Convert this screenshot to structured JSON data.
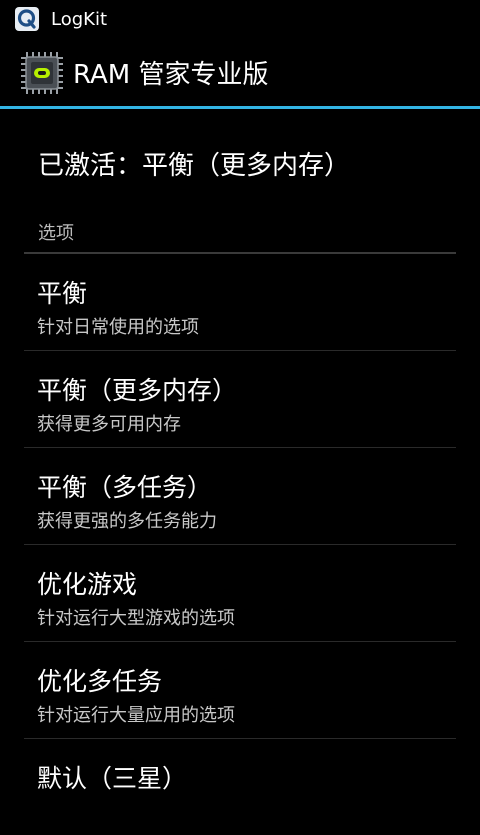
{
  "status_bar": {
    "title": "LogKit",
    "icon": "logkit-icon"
  },
  "action_bar": {
    "title": "RAM 管家专业版",
    "icon": "chip-icon",
    "accent_color": "#33b5e5"
  },
  "active_status": "已激活：平衡（更多内存）",
  "section_header": "选项",
  "options": [
    {
      "title": "平衡",
      "summary": "针对日常使用的选项"
    },
    {
      "title": "平衡（更多内存）",
      "summary": "获得更多可用内存"
    },
    {
      "title": "平衡（多任务）",
      "summary": "获得更强的多任务能力"
    },
    {
      "title": "优化游戏",
      "summary": "针对运行大型游戏的选项"
    },
    {
      "title": "优化多任务",
      "summary": "针对运行大量应用的选项"
    },
    {
      "title": "默认（三星）",
      "summary": ""
    }
  ]
}
